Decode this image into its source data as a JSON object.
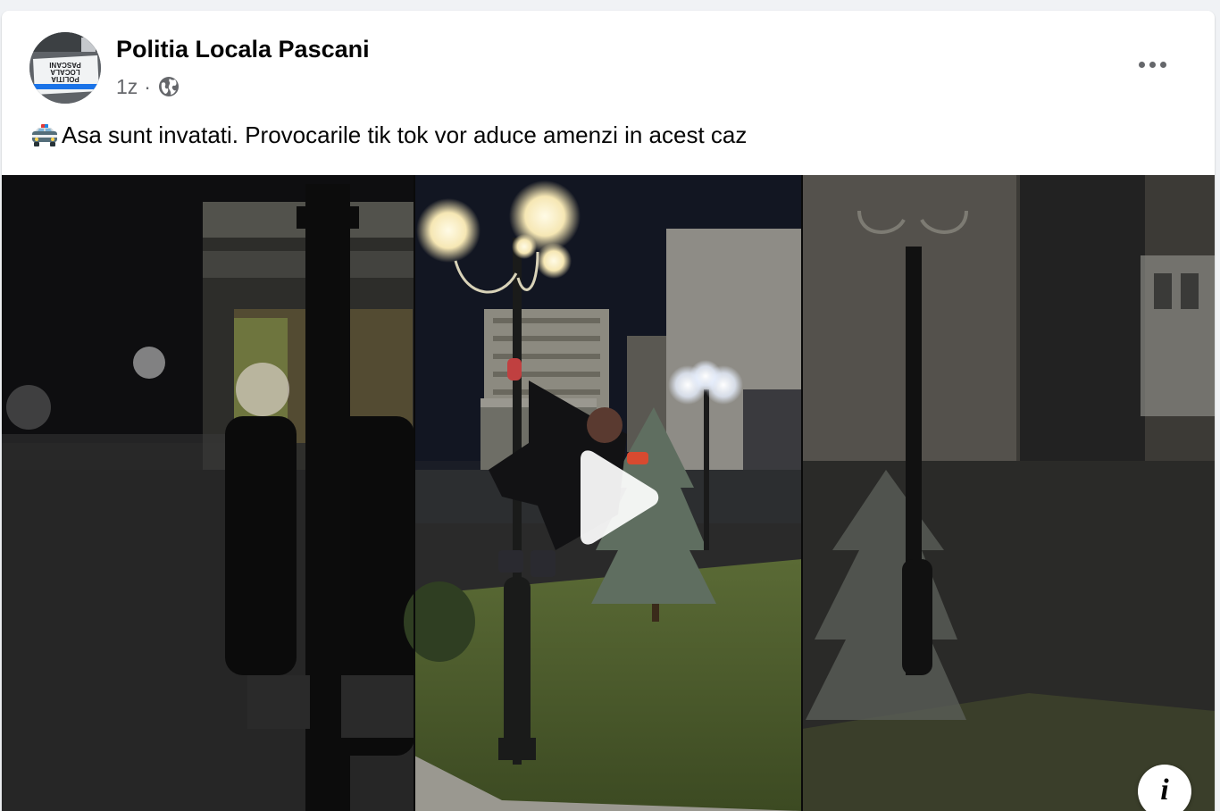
{
  "post": {
    "author": "Politia Locala Pascani",
    "avatar_text": [
      "POLITIA",
      "LOCALA",
      "PASCANI"
    ],
    "time": "1z",
    "separator": "·",
    "audience_icon": "globe-icon",
    "more_icon": "more-options-icon",
    "emoji_icon": "police-car-emoji",
    "text": "Asa sunt invatati. Provocarile tik tok vor aduce amenzi in acest caz"
  },
  "video": {
    "play_icon": "play-icon",
    "info_label": "i"
  },
  "colors": {
    "background": "#f0f2f5",
    "card": "#ffffff",
    "text_primary": "#050505",
    "text_secondary": "#65676b"
  }
}
